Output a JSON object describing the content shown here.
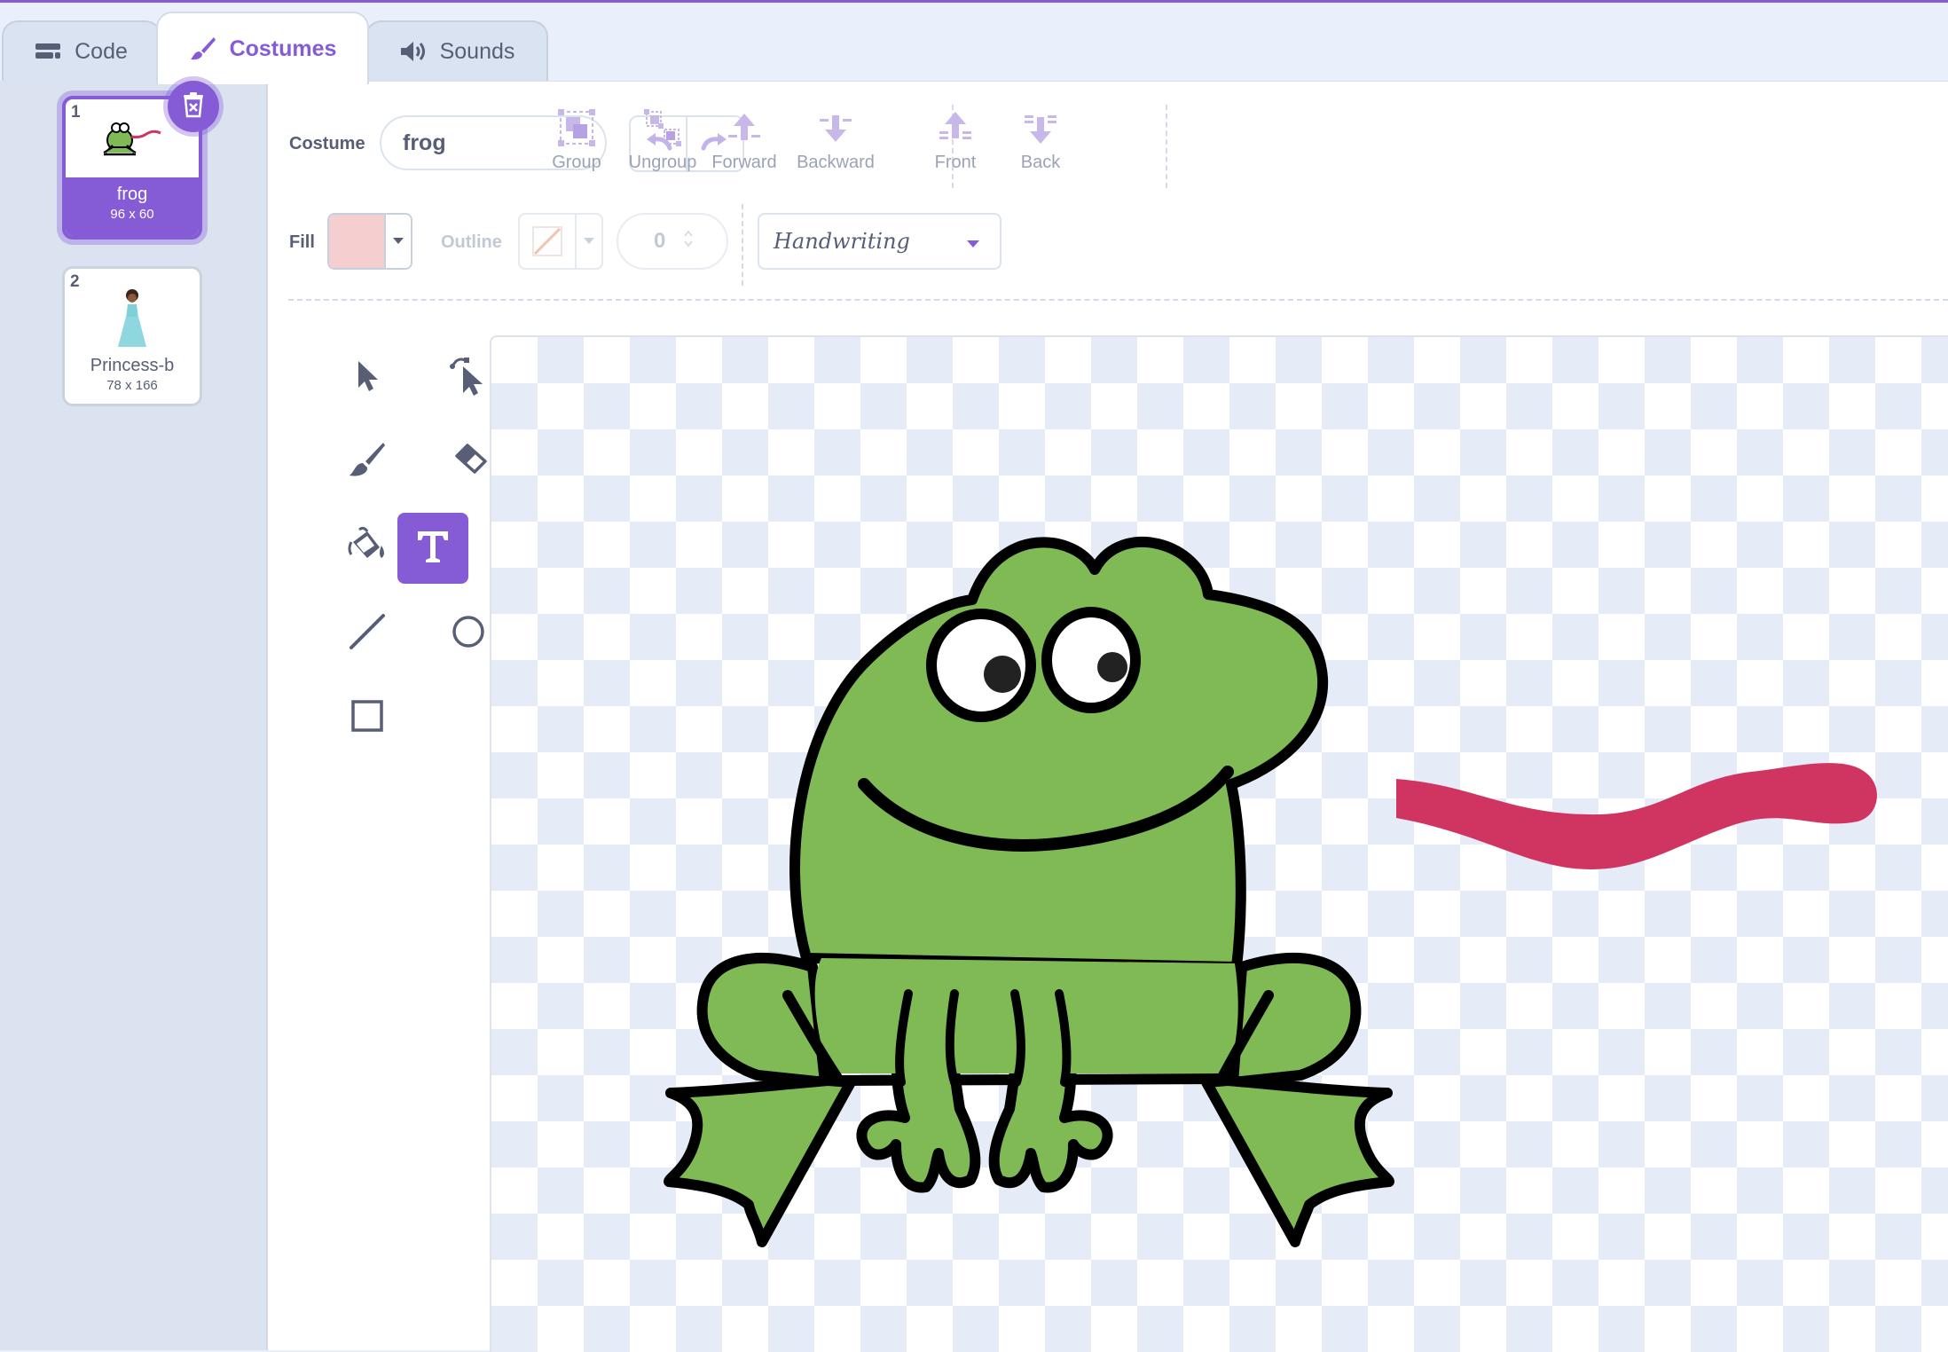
{
  "tabs": [
    {
      "label": "Code",
      "icon": "code-icon"
    },
    {
      "label": "Costumes",
      "icon": "paintbrush-icon"
    },
    {
      "label": "Sounds",
      "icon": "speaker-icon"
    }
  ],
  "costumes": [
    {
      "number": "1",
      "name": "frog",
      "size": "96 x 60",
      "selected": true
    },
    {
      "number": "2",
      "name": "Princess-b",
      "size": "78 x 166",
      "selected": false
    }
  ],
  "toolbar": {
    "costume_label": "Costume",
    "costume_name": "frog",
    "group": "Group",
    "ungroup": "Ungroup",
    "forward": "Forward",
    "backward": "Backward",
    "front": "Front",
    "back": "Back"
  },
  "style_bar": {
    "fill_label": "Fill",
    "outline_label": "Outline",
    "outline_width": "0",
    "font": "Handwriting"
  },
  "tools": [
    {
      "name": "select",
      "active": false
    },
    {
      "name": "reshape",
      "active": false
    },
    {
      "name": "brush",
      "active": false
    },
    {
      "name": "eraser",
      "active": false
    },
    {
      "name": "fill",
      "active": false
    },
    {
      "name": "text",
      "active": true
    },
    {
      "name": "line",
      "active": false
    },
    {
      "name": "circle",
      "active": false
    },
    {
      "name": "rectangle",
      "active": false
    }
  ],
  "colors": {
    "accent": "#855cd6",
    "fill_color": "#f5cfcf",
    "frog_green": "#7fba55",
    "tongue": "#cf3560"
  }
}
